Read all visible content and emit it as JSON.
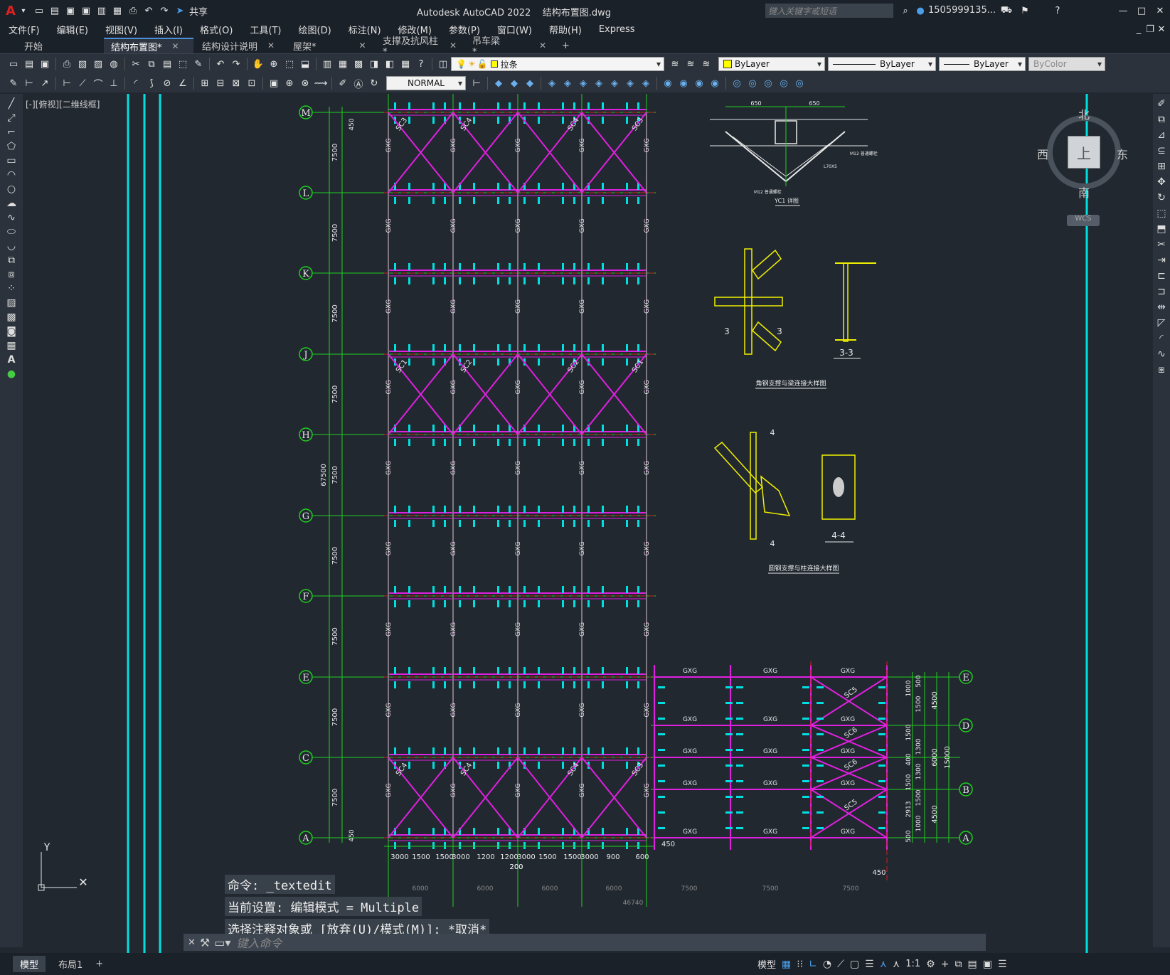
{
  "app": {
    "title": "Autodesk AutoCAD 2022",
    "filename": "结构布置图.dwg",
    "share": "共享",
    "search_placeholder": "键入关键字或短语",
    "user": "1505999135..."
  },
  "menu": [
    "文件(F)",
    "编辑(E)",
    "视图(V)",
    "插入(I)",
    "格式(O)",
    "工具(T)",
    "绘图(D)",
    "标注(N)",
    "修改(M)",
    "参数(P)",
    "窗口(W)",
    "帮助(H)",
    "Express"
  ],
  "tabs": [
    {
      "label": "开始"
    },
    {
      "label": "结构布置图*"
    },
    {
      "label": "结构设计说明"
    },
    {
      "label": "屋架*"
    },
    {
      "label": "支撑及抗风柱*"
    },
    {
      "label": "吊车梁*"
    }
  ],
  "toolbar": {
    "layer": "拉条",
    "color": "ByLayer",
    "linetype": "ByLayer",
    "lineweight": "ByLayer",
    "plotstyle": "ByColor",
    "textstyle": "NORMAL"
  },
  "viewport_label": "[-][俯视][二维线框]",
  "viewcube": {
    "north": "北",
    "south": "南",
    "east": "东",
    "west": "西",
    "top": "上",
    "wcs": "WCS"
  },
  "command": {
    "history": [
      "命令: _textedit",
      "当前设置: 编辑模式 = Multiple",
      "选择注释对象或 [放弃(U)/模式(M)]: *取消*"
    ],
    "placeholder": "键入命令"
  },
  "layout_tabs": [
    "模型",
    "布局1"
  ],
  "status": {
    "model": "模型",
    "scale": "1:1"
  },
  "drawing": {
    "grid_rows": [
      "M",
      "L",
      "K",
      "J",
      "H",
      "G",
      "F",
      "E",
      "C",
      "A"
    ],
    "right_rows": [
      "E",
      "D",
      "B",
      "A"
    ],
    "span_label": "7500",
    "total_label": "67500",
    "half_label": "450",
    "bottom_dims": [
      "3000",
      "1500",
      "1500",
      "3000",
      "1200",
      "1200",
      "3000",
      "1500",
      "1500",
      "3000",
      "900",
      "600",
      "200",
      "200"
    ],
    "bottom_spans": [
      "6000",
      "6000",
      "6000",
      "6000",
      "7500",
      "7500",
      "7500"
    ],
    "overall": "46740",
    "member": "GXG",
    "braces_top": [
      "SC3",
      "SC4",
      "SC4",
      "SC3"
    ],
    "braces_mid": [
      "SC1",
      "SC2",
      "SC2",
      "SC1"
    ],
    "braces_bot": [
      "SC4",
      "SC4",
      "SC4",
      "SC3"
    ],
    "braces_right": [
      "SC5",
      "SC6",
      "SC6",
      "SC5"
    ],
    "right_dims": [
      "500",
      "1000",
      "1500",
      "1500",
      "1300",
      "400",
      "1300",
      "1500",
      "1500",
      "2913",
      "1000",
      "500"
    ],
    "right_dims2": [
      "4500",
      "6000",
      "4500"
    ],
    "right_total": "15000",
    "detail_titles": [
      "YC1 详图",
      "角钢支撑与梁连接大样图",
      "圆钢支撑与柱连接大样图"
    ],
    "sections": [
      "3-3",
      "4-4",
      "3",
      "3",
      "4",
      "4"
    ],
    "detail_dims": [
      "650",
      "650",
      "M12 普通螺栓",
      "L70X5",
      "M12 普通螺栓"
    ]
  }
}
